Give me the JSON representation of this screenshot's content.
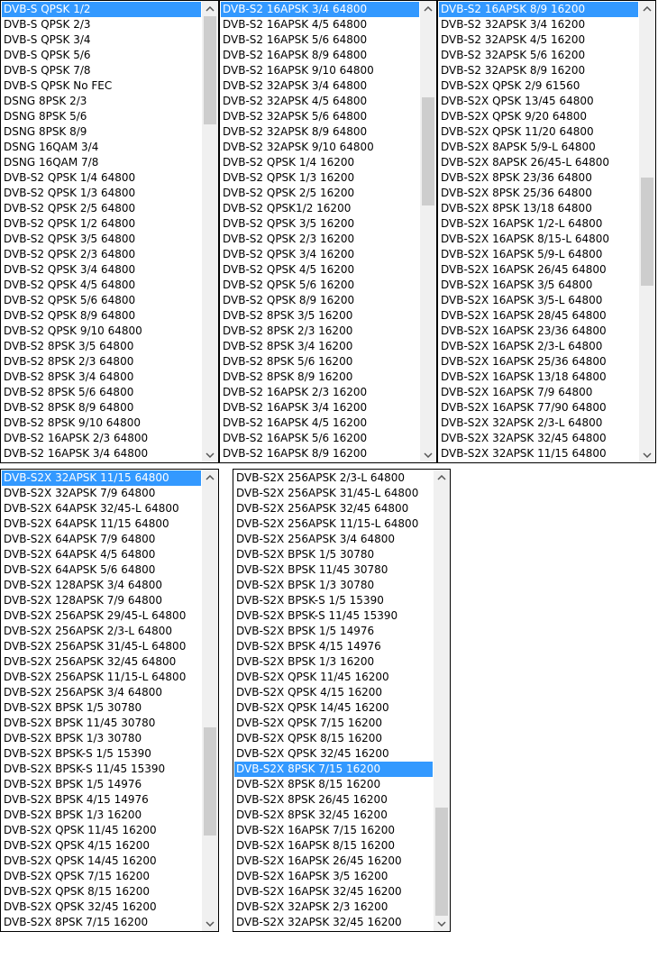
{
  "lists": [
    {
      "selected_index": 0,
      "scroll_fraction": 0.0,
      "thumb_fraction": 0.25,
      "items": [
        "DVB-S QPSK 1/2",
        "DVB-S QPSK 2/3",
        "DVB-S QPSK 3/4",
        "DVB-S QPSK 5/6",
        "DVB-S QPSK 7/8",
        "DVB-S QPSK No FEC",
        "DSNG 8PSK 2/3",
        "DSNG 8PSK 5/6",
        "DSNG 8PSK 8/9",
        "DSNG 16QAM 3/4",
        "DSNG 16QAM 7/8",
        "DVB-S2 QPSK 1/4 64800",
        "DVB-S2 QPSK 1/3 64800",
        "DVB-S2 QPSK 2/5 64800",
        "DVB-S2 QPSK 1/2 64800",
        "DVB-S2 QPSK 3/5 64800",
        "DVB-S2 QPSK 2/3 64800",
        "DVB-S2 QPSK 3/4 64800",
        "DVB-S2 QPSK 4/5 64800",
        "DVB-S2 QPSK 5/6 64800",
        "DVB-S2 QPSK 8/9 64800",
        "DVB-S2 QPSK 9/10 64800",
        "DVB-S2 8PSK 3/5 64800",
        "DVB-S2 8PSK 2/3 64800",
        "DVB-S2 8PSK 3/4 64800",
        "DVB-S2 8PSK 5/6 64800",
        "DVB-S2 8PSK 8/9 64800",
        "DVB-S2 8PSK 9/10 64800",
        "DVB-S2 16APSK 2/3 64800",
        "DVB-S2 16APSK 3/4 64800"
      ]
    },
    {
      "selected_index": 0,
      "scroll_fraction": 0.25,
      "thumb_fraction": 0.25,
      "items": [
        "DVB-S2 16APSK 3/4 64800",
        "DVB-S2 16APSK 4/5 64800",
        "DVB-S2 16APSK 5/6 64800",
        "DVB-S2 16APSK 8/9 64800",
        "DVB-S2 16APSK 9/10 64800",
        "DVB-S2 32APSK 3/4 64800",
        "DVB-S2 32APSK 4/5 64800",
        "DVB-S2 32APSK 5/6 64800",
        "DVB-S2 32APSK 8/9 64800",
        "DVB-S2 32APSK 9/10 64800",
        "DVB-S2 QPSK 1/4 16200",
        "DVB-S2 QPSK 1/3 16200",
        "DVB-S2 QPSK 2/5 16200",
        "DVB-S2 QPSK1/2 16200",
        "DVB-S2 QPSK 3/5 16200",
        "DVB-S2 QPSK 2/3 16200",
        "DVB-S2 QPSK 3/4 16200",
        "DVB-S2 QPSK 4/5 16200",
        "DVB-S2 QPSK 5/6 16200",
        "DVB-S2 QPSK 8/9 16200",
        "DVB-S2 8PSK 3/5 16200",
        "DVB-S2 8PSK 2/3 16200",
        "DVB-S2 8PSK 3/4 16200",
        "DVB-S2 8PSK 5/6 16200",
        "DVB-S2 8PSK 8/9 16200",
        "DVB-S2 16APSK 2/3 16200",
        "DVB-S2 16APSK 3/4 16200",
        "DVB-S2 16APSK 4/5 16200",
        "DVB-S2 16APSK 5/6 16200",
        "DVB-S2 16APSK 8/9 16200"
      ]
    },
    {
      "selected_index": 0,
      "scroll_fraction": 0.5,
      "thumb_fraction": 0.25,
      "items": [
        "DVB-S2 16APSK 8/9 16200",
        "DVB-S2 32APSK 3/4 16200",
        "DVB-S2 32APSK 4/5 16200",
        "DVB-S2 32APSK 5/6 16200",
        "DVB-S2 32APSK 8/9 16200",
        "DVB-S2X QPSK 2/9 61560",
        "DVB-S2X QPSK 13/45 64800",
        "DVB-S2X QPSK 9/20 64800",
        "DVB-S2X QPSK 11/20 64800",
        "DVB-S2X 8APSK 5/9-L 64800",
        "DVB-S2X 8APSK 26/45-L 64800",
        "DVB-S2X 8PSK 23/36 64800",
        "DVB-S2X 8PSK 25/36 64800",
        "DVB-S2X 8PSK 13/18 64800",
        "DVB-S2X 16APSK 1/2-L 64800",
        "DVB-S2X 16APSK 8/15-L 64800",
        "DVB-S2X 16APSK 5/9-L 64800",
        "DVB-S2X 16APSK 26/45 64800",
        "DVB-S2X 16APSK 3/5 64800",
        "DVB-S2X 16APSK 3/5-L 64800",
        "DVB-S2X 16APSK 28/45 64800",
        "DVB-S2X 16APSK 23/36 64800",
        "DVB-S2X 16APSK 2/3-L 64800",
        "DVB-S2X 16APSK 25/36 64800",
        "DVB-S2X 16APSK 13/18 64800",
        "DVB-S2X 16APSK 7/9 64800",
        "DVB-S2X 16APSK 77/90 64800",
        "DVB-S2X 32APSK 2/3-L 64800",
        "DVB-S2X 32APSK 32/45 64800",
        "DVB-S2X 32APSK 11/15 64800"
      ]
    },
    {
      "selected_index": 0,
      "scroll_fraction": 0.75,
      "thumb_fraction": 0.25,
      "items": [
        "DVB-S2X 32APSK 11/15 64800",
        "DVB-S2X 32APSK 7/9 64800",
        "DVB-S2X 64APSK 32/45-L 64800",
        "DVB-S2X 64APSK 11/15 64800",
        "DVB-S2X 64APSK 7/9 64800",
        "DVB-S2X 64APSK 4/5 64800",
        "DVB-S2X 64APSK 5/6 64800",
        "DVB-S2X 128APSK 3/4 64800",
        "DVB-S2X 128APSK 7/9 64800",
        "DVB-S2X 256APSK 29/45-L 64800",
        "DVB-S2X 256APSK 2/3-L 64800",
        "DVB-S2X 256APSK 31/45-L 64800",
        "DVB-S2X 256APSK 32/45 64800",
        "DVB-S2X 256APSK 11/15-L 64800",
        "DVB-S2X 256APSK 3/4 64800",
        "DVB-S2X BPSK 1/5 30780",
        "DVB-S2X BPSK 11/45 30780",
        "DVB-S2X BPSK 1/3 30780",
        "DVB-S2X BPSK-S 1/5 15390",
        "DVB-S2X BPSK-S 11/45 15390",
        "DVB-S2X BPSK 1/5 14976",
        "DVB-S2X BPSK 4/15 14976",
        "DVB-S2X BPSK 1/3 16200",
        "DVB-S2X QPSK 11/45 16200",
        "DVB-S2X QPSK 4/15 16200",
        "DVB-S2X QPSK 14/45 16200",
        "DVB-S2X QPSK 7/15 16200",
        "DVB-S2X QPSK 8/15 16200",
        "DVB-S2X QPSK 32/45 16200",
        "DVB-S2X 8PSK 7/15 16200"
      ]
    },
    {
      "selected_index": 19,
      "scroll_fraction": 1.0,
      "thumb_fraction": 0.25,
      "items": [
        "DVB-S2X 256APSK 2/3-L 64800",
        "DVB-S2X 256APSK 31/45-L 64800",
        "DVB-S2X 256APSK 32/45 64800",
        "DVB-S2X 256APSK 11/15-L 64800",
        "DVB-S2X 256APSK 3/4 64800",
        "DVB-S2X BPSK 1/5 30780",
        "DVB-S2X BPSK 11/45 30780",
        "DVB-S2X BPSK 1/3 30780",
        "DVB-S2X BPSK-S 1/5 15390",
        "DVB-S2X BPSK-S 11/45 15390",
        "DVB-S2X BPSK 1/5 14976",
        "DVB-S2X BPSK 4/15 14976",
        "DVB-S2X BPSK 1/3 16200",
        "DVB-S2X QPSK 11/45 16200",
        "DVB-S2X QPSK 4/15 16200",
        "DVB-S2X QPSK 14/45 16200",
        "DVB-S2X QPSK 7/15 16200",
        "DVB-S2X QPSK 8/15 16200",
        "DVB-S2X QPSK 32/45 16200",
        "DVB-S2X 8PSK 7/15 16200",
        "DVB-S2X 8PSK 8/15 16200",
        "DVB-S2X 8PSK 26/45 16200",
        "DVB-S2X 8PSK 32/45 16200",
        "DVB-S2X 16APSK 7/15 16200",
        "DVB-S2X 16APSK 8/15 16200",
        "DVB-S2X 16APSK 26/45 16200",
        "DVB-S2X 16APSK 3/5 16200",
        "DVB-S2X 16APSK 32/45 16200",
        "DVB-S2X 32APSK 2/3 16200",
        "DVB-S2X 32APSK 32/45 16200"
      ]
    }
  ],
  "icons": {
    "up": "chevron-up-icon",
    "down": "chevron-down-icon"
  },
  "colors": {
    "selection": "#3399ff",
    "scrollbar_track": "#f0f0f0",
    "scrollbar_thumb": "#cdcdcd"
  }
}
